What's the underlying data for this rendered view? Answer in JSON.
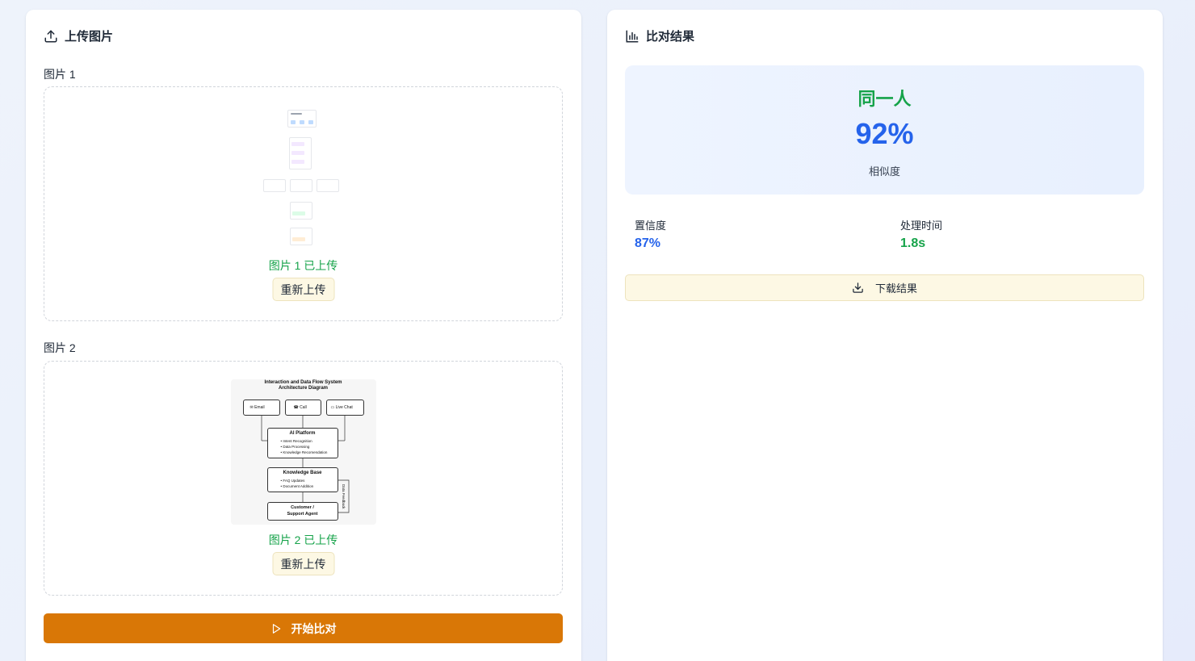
{
  "upload_panel": {
    "title": "上传图片",
    "image1": {
      "label": "图片 1",
      "status": "图片 1 已上传",
      "reupload_label": "重新上传"
    },
    "image2": {
      "label": "图片 2",
      "status": "图片 2 已上传",
      "reupload_label": "重新上传",
      "diagram": {
        "title_line1": "Interaction and Data Flow System",
        "title_line2": "Architecture Diagram",
        "channels": [
          "Email",
          "Call",
          "Live Chat"
        ],
        "ai_platform": {
          "title": "AI Platform",
          "items": [
            "• Intent Recognition",
            "• Data Processing",
            "• Knowledge Recomendation"
          ]
        },
        "knowledge_base": {
          "title": "Knowledge Base",
          "items": [
            "• FAQ Updates",
            "• Document Addition"
          ]
        },
        "customer_line1": "Customer /",
        "customer_line2": "Support Agent",
        "feedback_label": "Data Feedback"
      }
    },
    "start_label": "开始比对"
  },
  "result_panel": {
    "title": "比对结果",
    "verdict": "同一人",
    "similarity": "92%",
    "similarity_label": "相似度",
    "confidence_label": "置信度",
    "confidence_value": "87%",
    "time_label": "处理时间",
    "time_value": "1.8s",
    "download_label": "下载结果"
  },
  "colors": {
    "accent": "#d97706",
    "success": "#16a34a",
    "primary": "#2563eb",
    "button_bg": "#fdf8e4"
  },
  "icons": [
    "upload-icon",
    "bar-chart-icon",
    "play-icon",
    "download-icon"
  ]
}
